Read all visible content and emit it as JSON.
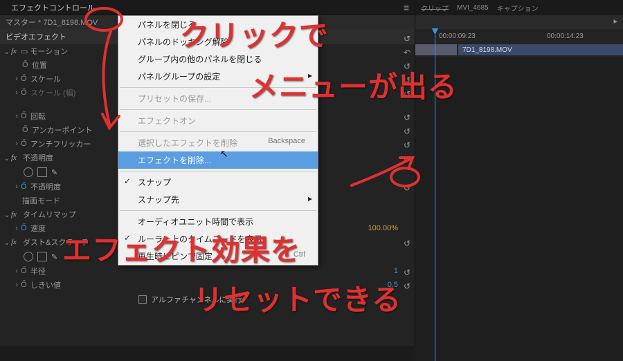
{
  "tabs": {
    "effect_controls": "エフェクトコントロール"
  },
  "master_label": "マスター * 7D1_8198.MOV",
  "video_effects_label": "ビデオエフェクト",
  "props": {
    "motion": "モーション",
    "position": "位置",
    "scale": "スケール",
    "scale_w": "スケール (幅)",
    "rotation": "回転",
    "anchor": "アンカーポイント",
    "antiflicker": "アンチフリッカー",
    "opacity_group": "不透明度",
    "opacity": "不透明度",
    "blend": "描画モード",
    "timeremap_group": "タイムリマップ",
    "speed": "速度",
    "dust_group": "ダスト&スクラッチ",
    "radius": "半径",
    "threshold": "しきい値"
  },
  "values": {
    "speed": "100.00%",
    "radius": "1",
    "threshold": "0.5"
  },
  "alpha_label": "アルファチャンネルに実行",
  "right_tabs": {
    "clip": "クリップ",
    "mvi": "MVI_4685",
    "caption": "キャプション"
  },
  "timecodes": {
    "a": "00:00:09:23",
    "b": "00:00:14:23"
  },
  "clip_name": "7D1_8198.MOV",
  "menu": {
    "close_panel": "パネルを閉じる",
    "dock_panel": "パネルのドッキング解除",
    "close_others": "グループ内の他のパネルを閉じる",
    "panel_group_settings": "パネルグループの設定",
    "save_preset": "プリセットの保存...",
    "effect_on": "エフェクトオン",
    "remove_selected": "選択したエフェクトを削除",
    "remove_effects": "エフェクトを削除...",
    "snap": "スナップ",
    "snap_to": "スナップ先",
    "audio_units": "オーディオユニット時間で表示",
    "ruler_tc": "ルーラー上のタイムコードを表示",
    "pin_playhead": "再生時にピンで固定",
    "shortcut_backspace": "Backspace",
    "shortcut_ctrl": "Ctrl"
  },
  "annotations": {
    "line1": "クリックで",
    "line2": "メニューが出る",
    "line3": "エフェクト効果を",
    "line4": "リセットできる"
  }
}
